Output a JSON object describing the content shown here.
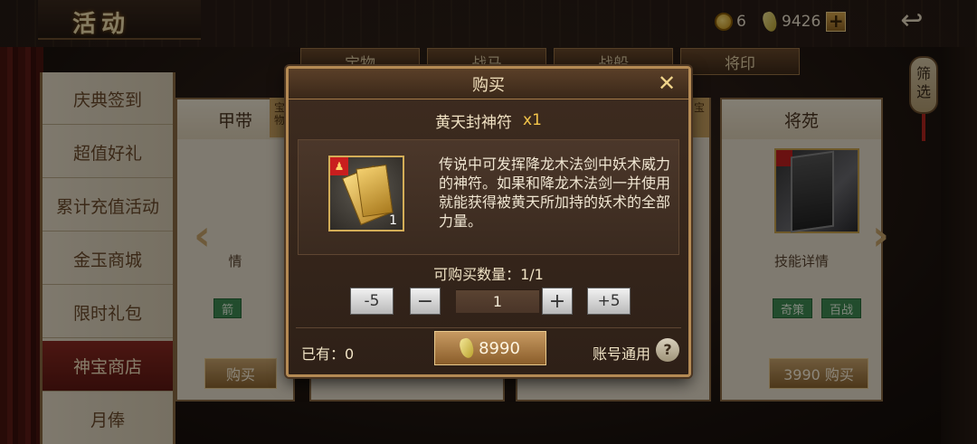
{
  "header": {
    "title": "活动",
    "coins": "6",
    "jade": "9426",
    "plus_label": "+",
    "back_label": "↩"
  },
  "sidebar": {
    "items": [
      {
        "label": "庆典签到"
      },
      {
        "label": "超值好礼"
      },
      {
        "label": "累计充值活动"
      },
      {
        "label": "金玉商城"
      },
      {
        "label": "限时礼包"
      },
      {
        "label": "神宝商店"
      },
      {
        "label": "月俸"
      }
    ],
    "active_index": 5
  },
  "tabs": [
    {
      "label": "宝物"
    },
    {
      "label": "战马"
    },
    {
      "label": "战船"
    },
    {
      "label": "将印"
    }
  ],
  "filter_label": "筛选",
  "cards": {
    "left_title": "甲带",
    "left_tag": "箭",
    "left_skill": "情",
    "left_buy": "购买",
    "right_title": "将苑",
    "right_skill": "技能详情",
    "right_tags": [
      "奇策",
      "百战"
    ],
    "right_buy": "3990 购买",
    "side_stamp_left": "宝物",
    "side_stamp_right": "宝"
  },
  "modal": {
    "title": "购买",
    "close": "✕",
    "item_name": "黄天封神符",
    "item_qty": "x1",
    "item_count": "1",
    "description": "传说中可发挥降龙木法剑中妖术威力的神符。如果和降龙木法剑一并使用就能获得被黄天所加持的妖术的全部力量。",
    "buyable_label": "可购买数量：1/1",
    "minus5": "-5",
    "minus": "−",
    "qty_value": "1",
    "plus": "+",
    "plus5": "+5",
    "owned": "已有：0",
    "price": "8990",
    "account_label": "账号通用",
    "help": "?"
  },
  "colors": {
    "accent_gold": "#b48a54",
    "active_red": "#8a2a22",
    "tag_green": "#3e8a52"
  }
}
